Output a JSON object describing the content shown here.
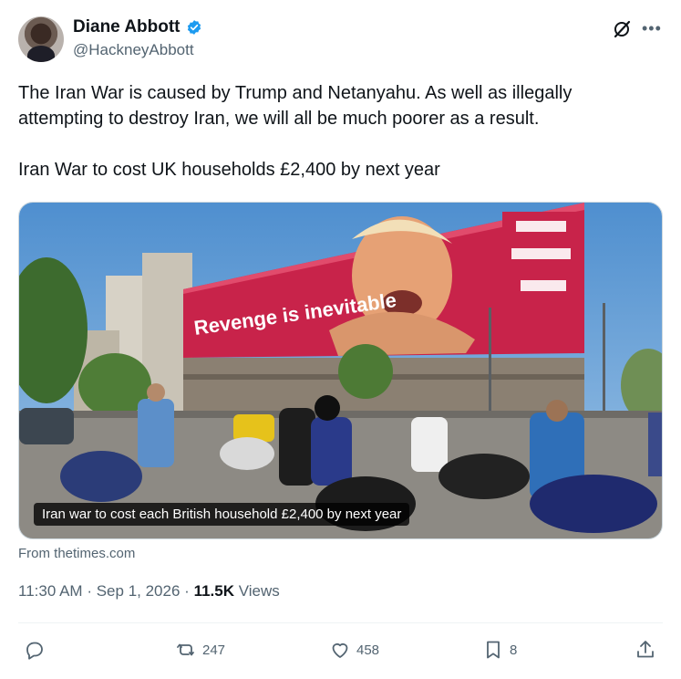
{
  "author": {
    "name": "Diane Abbott",
    "handle": "@HackneyAbbott"
  },
  "tweet": {
    "line1": "The Iran War is caused by Trump and Netanyahu. As well as illegally attempting to destroy Iran, we will all be much poorer as a result.",
    "line2": "Iran War to cost UK households £2,400 by next year"
  },
  "media": {
    "caption": "Iran war to cost each British household £2,400 by next year",
    "billboard_text": "Revenge is inevitable"
  },
  "source": "From thetimes.com",
  "meta": {
    "time": "11:30 AM",
    "separator": "·",
    "date": "Sep 1, 2026",
    "views_count": "11.5K",
    "views_label": "Views"
  },
  "actions": {
    "retweets": "247",
    "likes": "458",
    "bookmarks": "8"
  },
  "colors": {
    "verified": "#1d9bf0",
    "secondary_text": "#536471",
    "billboard": "#c8234a"
  },
  "icons": [
    "verified-badge-icon",
    "grok-icon",
    "more-icon",
    "reply-icon",
    "retweet-icon",
    "like-icon",
    "bookmark-icon",
    "share-icon"
  ]
}
